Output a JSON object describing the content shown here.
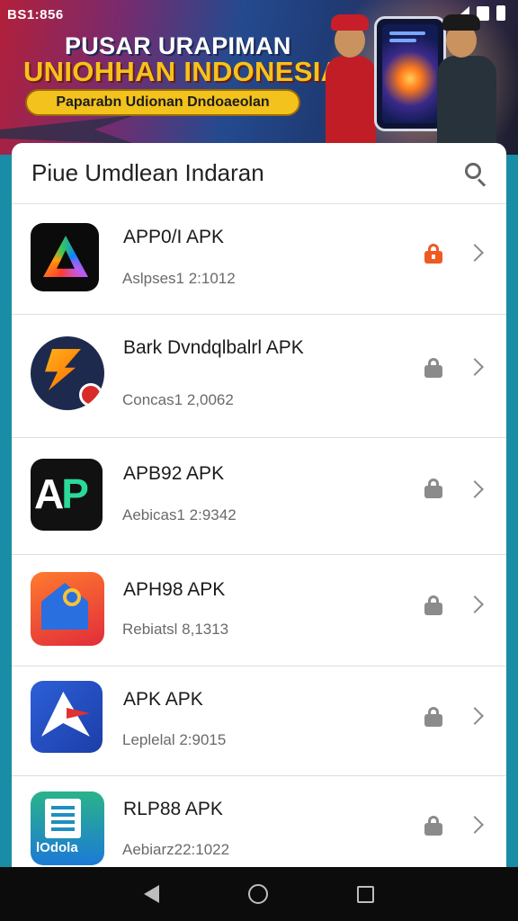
{
  "status_bar": {
    "time": "BS1:856"
  },
  "banner": {
    "title_line1": "PUSAR URAPIMAN",
    "title_line2": "UNIOHHAN INDONESIA",
    "subtitle": "Paparabn Udionan Dndoaeolan"
  },
  "search": {
    "title": "Piue  Umdlean Indaran"
  },
  "apps": [
    {
      "name": "APP0/I APK",
      "date": "Aslpses1 2:1012",
      "icon": "colorful-triangle-icon",
      "lock_color": "#ee5a22"
    },
    {
      "name": "Bark Dvndqlbalrl APK",
      "date": "Concas1 2,0062",
      "icon": "orange-bolt-icon",
      "lock_color": "#8b8b8b"
    },
    {
      "name": "APB92 APK",
      "date": "Aebicas1 2:9342",
      "icon": "ap-letters-icon",
      "lock_color": "#8b8b8b"
    },
    {
      "name": "APH98 APK",
      "date": "Rebiatsl 8,1313",
      "icon": "house-magnifier-icon",
      "lock_color": "#8b8b8b"
    },
    {
      "name": "APK APK",
      "date": "Leplelal 2:9015",
      "icon": "paper-plane-icon",
      "lock_color": "#8b8b8b"
    },
    {
      "name": "RLP88 APK",
      "date": "Aebiarz22:1022",
      "icon": "document-list-icon",
      "lock_color": "#8b8b8b"
    }
  ],
  "icon_text": {
    "app2_badge": "",
    "app6_label": "lOdola"
  },
  "colors": {
    "accent_lock": "#ee5a22",
    "banner_gold": "#f3c21c",
    "background_teal": "#1a8da6"
  }
}
